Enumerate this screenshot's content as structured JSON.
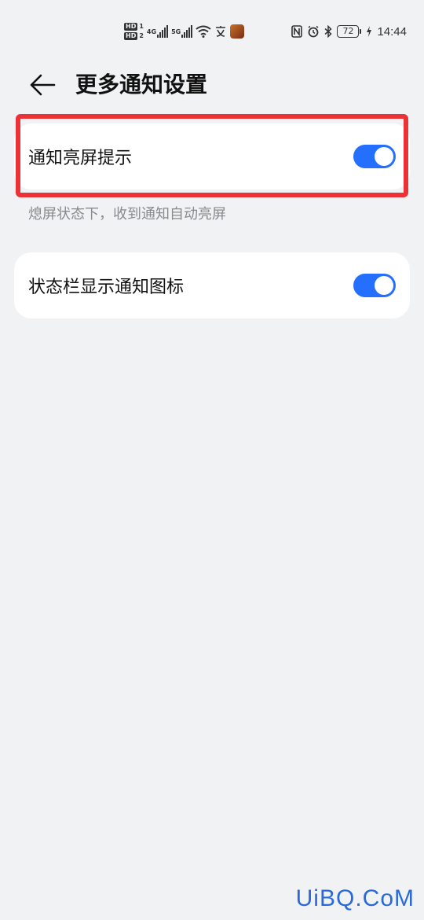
{
  "status_bar": {
    "sim1_badge": "HD",
    "sim1_num": "1",
    "sim2_badge": "HD",
    "sim2_num": "2",
    "network1": "4G",
    "network2": "5G",
    "battery": "72",
    "time": "14:44",
    "icons_left": [
      "hd-sim1-icon",
      "hd-sim2-icon",
      "signal-4g-icon",
      "signal-5g-icon",
      "wifi-icon",
      "input-method-icon",
      "app-notification-icon"
    ],
    "icons_right": [
      "nfc-icon",
      "alarm-icon",
      "bluetooth-icon",
      "battery-icon",
      "charging-icon"
    ]
  },
  "header": {
    "title": "更多通知设置",
    "back_icon": "arrow-left-icon"
  },
  "settings": {
    "wake_screen": {
      "label": "通知亮屏提示",
      "description": "熄屏状态下，收到通知自动亮屏",
      "enabled": true
    },
    "status_bar_icons": {
      "label": "状态栏显示通知图标",
      "enabled": true
    }
  },
  "colors": {
    "accent": "#256fff",
    "highlight": "#ec3237",
    "background": "#f1f2f4",
    "card": "#ffffff",
    "watermark": "#2a6ad8"
  },
  "watermark": "UiBQ.CoM"
}
